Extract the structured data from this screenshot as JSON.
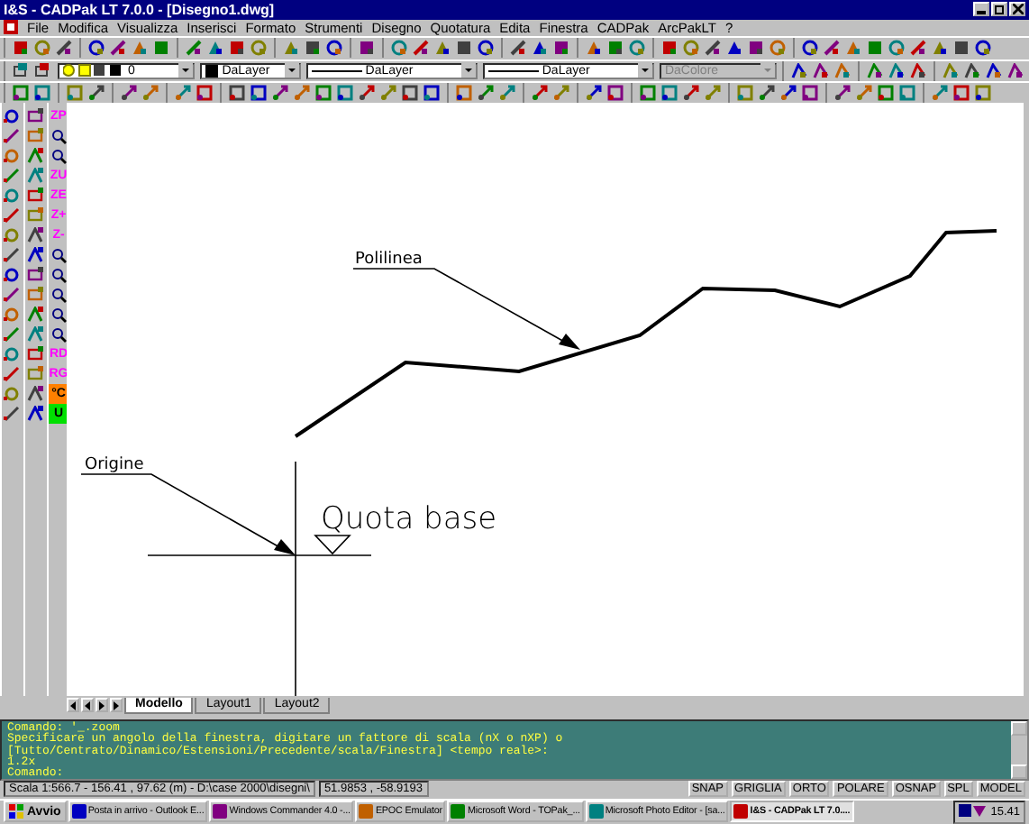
{
  "window": {
    "title": "I&S - CADPak LT 7.0.0 - [Disegno1.dwg]"
  },
  "menu": [
    "File",
    "Modifica",
    "Visualizza",
    "Inserisci",
    "Formato",
    "Strumenti",
    "Disegno",
    "Quotatura",
    "Edita",
    "Finestra",
    "CADPak",
    "ArcPakLT",
    "?"
  ],
  "properties_toolbar": [
    {
      "label": "0",
      "kind": "layer",
      "disabled": false
    },
    {
      "label": "DaLayer",
      "kind": "color",
      "disabled": false
    },
    {
      "label": "DaLayer",
      "kind": "linetype",
      "disabled": false
    },
    {
      "label": "DaLayer",
      "kind": "linetype",
      "disabled": false
    },
    {
      "label": "DaColore",
      "kind": "plain",
      "disabled": true
    }
  ],
  "zoom_toolbar": [
    {
      "kind": "text",
      "label": "ZP",
      "color": "#ff00ff"
    },
    {
      "kind": "icon"
    },
    {
      "kind": "icon"
    },
    {
      "kind": "text",
      "label": "ZU",
      "color": "#ff00ff"
    },
    {
      "kind": "text",
      "label": "ZE",
      "color": "#ff00ff"
    },
    {
      "kind": "text",
      "label": "Z+",
      "color": "#ff00ff"
    },
    {
      "kind": "text",
      "label": "Z-",
      "color": "#ff00ff"
    },
    {
      "kind": "icon"
    },
    {
      "kind": "icon"
    },
    {
      "kind": "icon"
    },
    {
      "kind": "icon"
    },
    {
      "kind": "icon"
    },
    {
      "kind": "text",
      "label": "RD",
      "color": "#ff00ff"
    },
    {
      "kind": "text",
      "label": "RG",
      "color": "#ff00ff"
    },
    {
      "kind": "badge",
      "label": "°C",
      "color": "#ff8000"
    },
    {
      "kind": "badge",
      "label": "U",
      "color": "#00e000"
    }
  ],
  "drawing": {
    "polyline_label": "Polilinea",
    "origin_label": "Origine",
    "base_label": "Quota base"
  },
  "layout_tabs": [
    {
      "label": "Modello",
      "selected": true
    },
    {
      "label": "Layout1",
      "selected": false
    },
    {
      "label": "Layout2",
      "selected": false
    }
  ],
  "command_lines": [
    "Comando: '_.zoom",
    "Specificare un angolo della finestra, digitare un fattore di scala (nX o nXP) o",
    "[Tutto/Centrato/Dinamico/Estensioni/Precedente/scala/Finestra] <tempo reale>:",
    "1.2x",
    "Comando:"
  ],
  "status_bar": {
    "info": "Scala 1:566.7 - 156.41 , 97.62 (m) - D:\\case 2000\\disegni\\",
    "coords": "51.9853 , -58.9193",
    "toggles": [
      "SNAP",
      "GRIGLIA",
      "ORTO",
      "POLARE",
      "OSNAP",
      "SPL",
      "MODEL"
    ]
  },
  "taskbar": {
    "start": "Avvio",
    "items": [
      {
        "label": "Posta in arrivo - Outlook E...",
        "selected": false
      },
      {
        "label": "Windows Commander 4.0 -...",
        "selected": false
      },
      {
        "label": "EPOC Emulator",
        "selected": false
      },
      {
        "label": "Microsoft Word - TOPak_...",
        "selected": false
      },
      {
        "label": "Microsoft Photo Editor - [sa...",
        "selected": false
      },
      {
        "label": "I&S - CADPak LT 7.0....",
        "selected": true
      }
    ],
    "clock": "15.41"
  }
}
